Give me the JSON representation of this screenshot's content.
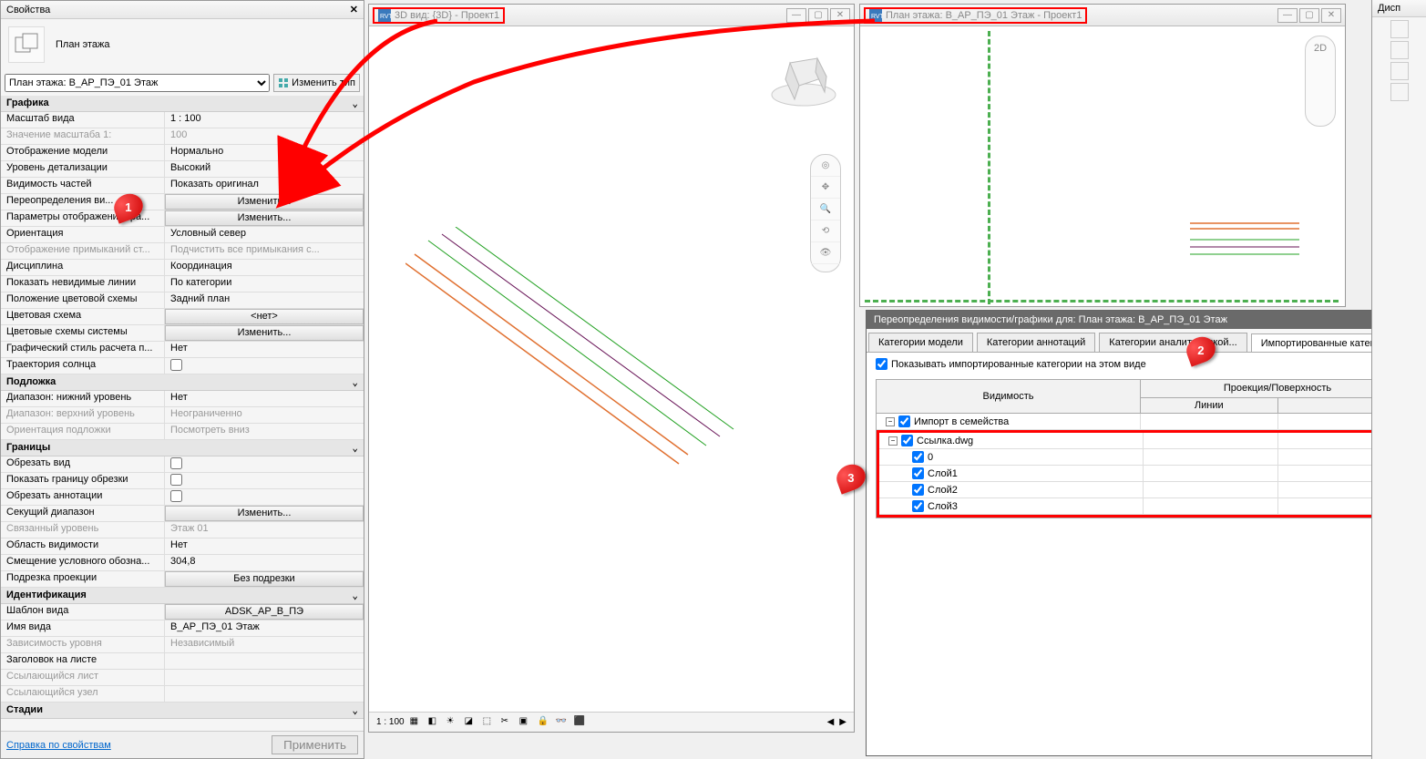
{
  "properties": {
    "title": "Свойства",
    "type_label": "План этажа",
    "selector_value": "План этажа: B_АР_ПЭ_01 Этаж",
    "edit_type": "Изменить тип",
    "help_link": "Справка по свойствам",
    "apply": "Применить",
    "groups": [
      {
        "name": "Графика",
        "rows": [
          {
            "k": "Масштаб вида",
            "v": "1 : 100"
          },
          {
            "k": "Значение масштаба    1:",
            "v": "100",
            "dis": true
          },
          {
            "k": "Отображение модели",
            "v": "Нормально"
          },
          {
            "k": "Уровень детализации",
            "v": "Высокий"
          },
          {
            "k": "Видимость частей",
            "v": "Показать оригинал"
          },
          {
            "k": "Переопределения ви...",
            "v": "Изменить...",
            "btn": true
          },
          {
            "k": "Параметры отображения гра...",
            "v": "Изменить...",
            "btn": true
          },
          {
            "k": "Ориентация",
            "v": "Условный север"
          },
          {
            "k": "Отображение примыканий ст...",
            "v": "Подчистить все примыкания с...",
            "dis": true
          },
          {
            "k": "Дисциплина",
            "v": "Координация"
          },
          {
            "k": "Показать невидимые линии",
            "v": "По категории"
          },
          {
            "k": "Положение цветовой схемы",
            "v": "Задний план"
          },
          {
            "k": "Цветовая схема",
            "v": "<нет>",
            "btn": true
          },
          {
            "k": "Цветовые схемы системы",
            "v": "Изменить...",
            "btn": true
          },
          {
            "k": "Графический стиль расчета п...",
            "v": "Нет"
          },
          {
            "k": "Траектория солнца",
            "v": "",
            "chk": true,
            "checked": false
          }
        ]
      },
      {
        "name": "Подложка",
        "rows": [
          {
            "k": "Диапазон: нижний уровень",
            "v": "Нет"
          },
          {
            "k": "Диапазон: верхний уровень",
            "v": "Неограниченно",
            "dis": true
          },
          {
            "k": "Ориентация подложки",
            "v": "Посмотреть вниз",
            "dis": true
          }
        ]
      },
      {
        "name": "Границы",
        "rows": [
          {
            "k": "Обрезать вид",
            "v": "",
            "chk": true,
            "checked": false
          },
          {
            "k": "Показать границу обрезки",
            "v": "",
            "chk": true,
            "checked": false
          },
          {
            "k": "Обрезать аннотации",
            "v": "",
            "chk": true,
            "checked": false
          },
          {
            "k": "Секущий диапазон",
            "v": "Изменить...",
            "btn": true
          },
          {
            "k": "Связанный уровень",
            "v": "Этаж 01",
            "dis": true
          },
          {
            "k": "Область видимости",
            "v": "Нет"
          },
          {
            "k": "Смещение условного обозна...",
            "v": "304,8"
          },
          {
            "k": "Подрезка проекции",
            "v": "Без подрезки",
            "btn": true
          }
        ]
      },
      {
        "name": "Идентификация",
        "rows": [
          {
            "k": "Шаблон вида",
            "v": "ADSK_АР_В_ПЭ",
            "btn": true
          },
          {
            "k": "Имя вида",
            "v": "B_АР_ПЭ_01 Этаж"
          },
          {
            "k": "Зависимость уровня",
            "v": "Независимый",
            "dis": true
          },
          {
            "k": "Заголовок на листе",
            "v": ""
          },
          {
            "k": "Ссылающийся лист",
            "v": "",
            "dis": true
          },
          {
            "k": "Ссылающийся узел",
            "v": "",
            "dis": true
          }
        ]
      },
      {
        "name": "Стадии",
        "rows": []
      }
    ]
  },
  "view3d": {
    "title": "3D вид: {3D} - Проект1",
    "scale": "1 : 100"
  },
  "viewplan": {
    "title": "План этажа: B_АР_ПЭ_01 Этаж - Проект1"
  },
  "vg": {
    "title": "Переопределения видимости/графики для: План этажа: B_АР_ПЭ_01 Этаж",
    "tabs": [
      "Категории модели",
      "Категории аннотаций",
      "Категории аналитической...",
      "Импортированные категории"
    ],
    "active_tab": 3,
    "show_imported": "Показывать импортированные категории на этом виде",
    "col_visibility": "Видимость",
    "col_projection": "Проекция/Поверхность",
    "col_lines": "Линии",
    "rows_top": [
      {
        "label": "Импорт в семейства",
        "checked": true
      }
    ],
    "tree_root": {
      "label": "Ссылка.dwg",
      "checked": true
    },
    "tree_children": [
      {
        "label": "0",
        "checked": true
      },
      {
        "label": "Слой1",
        "checked": true
      },
      {
        "label": "Слой2",
        "checked": true
      },
      {
        "label": "Слой3",
        "checked": true
      }
    ]
  },
  "rightbar": {
    "title": "Дисп"
  },
  "callouts": {
    "c1": "1",
    "c2": "2",
    "c3": "3"
  }
}
